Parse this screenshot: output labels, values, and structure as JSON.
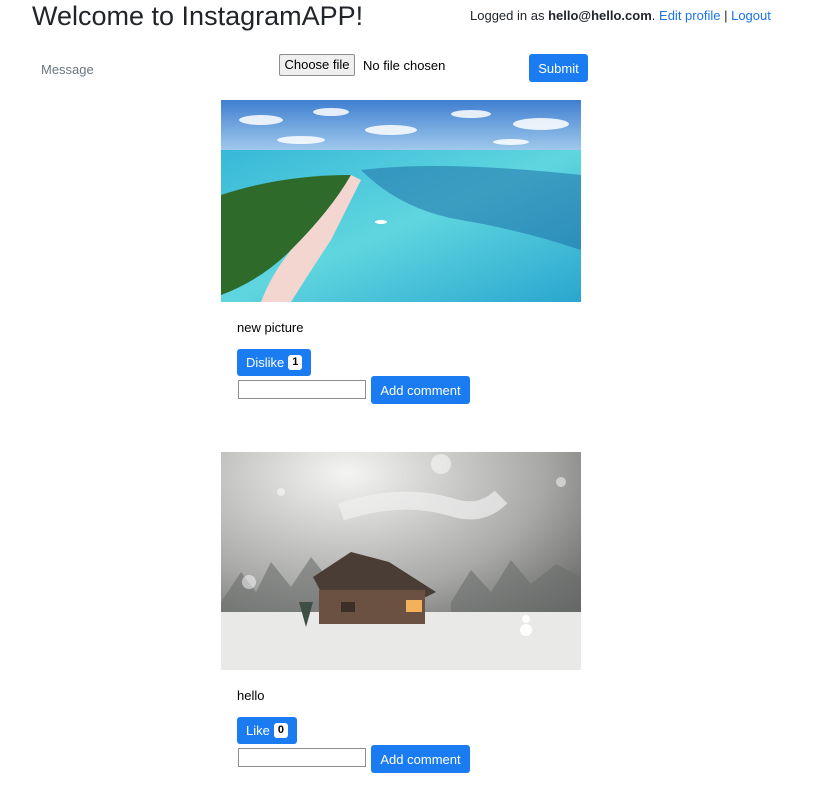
{
  "header": {
    "title": "Welcome to InstagramAPP!",
    "logged_prefix": "Logged in as ",
    "user_email": "hello@hello.com",
    "period": ".",
    "edit_profile": "Edit profile",
    "separator": "|",
    "logout": "Logout"
  },
  "upload": {
    "message_label": "Message",
    "choose_file": "Choose file",
    "file_status": "No file chosen",
    "submit": "Submit"
  },
  "posts": [
    {
      "image": "beach-aerial-photo",
      "caption": "new picture",
      "like_label": "Dislike",
      "like_count": "1",
      "comment_button": "Add comment"
    },
    {
      "image": "winter-cabin-photo",
      "caption": "hello",
      "like_label": "Like",
      "like_count": "0",
      "comment_button": "Add comment"
    }
  ],
  "colors": {
    "accent": "#1a7cf0",
    "link": "#1a73e8"
  }
}
